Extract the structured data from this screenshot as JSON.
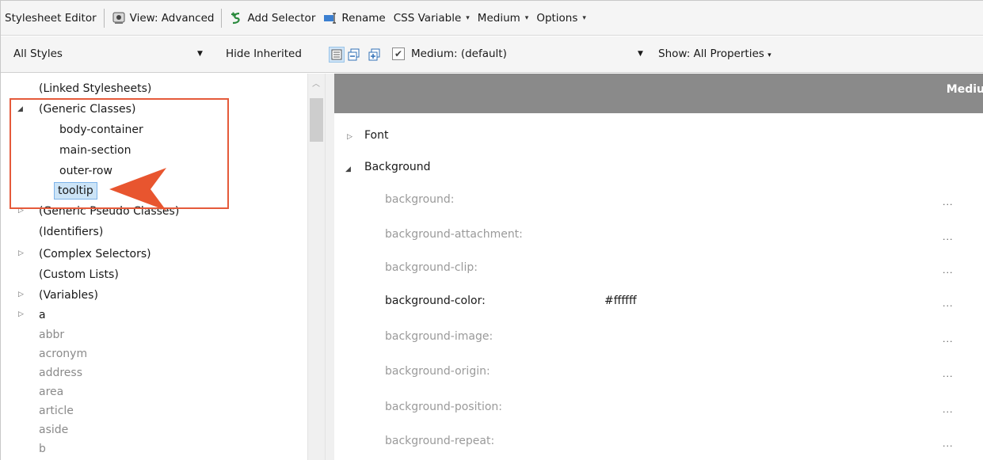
{
  "toolbar1": {
    "title": "Stylesheet Editor",
    "view": "View: Advanced",
    "add_selector": "Add Selector",
    "rename": "Rename",
    "css_variable": "CSS Variable",
    "medium": "Medium",
    "options": "Options"
  },
  "toolbar2": {
    "filter": "All Styles",
    "hide_inherited": "Hide Inherited",
    "medium_select": "Medium: (default)",
    "show": "Show: All Properties"
  },
  "tree": {
    "linked": "(Linked Stylesheets)",
    "generic_classes": "(Generic Classes)",
    "classes": [
      "body-container",
      "main-section",
      "outer-row",
      "tooltip"
    ],
    "generic_pseudo": "(Generic Pseudo Classes)",
    "identifiers": "(Identifiers)",
    "complex": "(Complex Selectors)",
    "custom_lists": "(Custom Lists)",
    "variables": "(Variables)",
    "a": "a",
    "tags": [
      "abbr",
      "acronym",
      "address",
      "area",
      "article",
      "aside",
      "b"
    ]
  },
  "right": {
    "header": "Mediu",
    "sections": {
      "font": "Font",
      "background": "Background"
    },
    "props": [
      {
        "name": "background:",
        "value": ""
      },
      {
        "name": "background-attachment:",
        "value": ""
      },
      {
        "name": "background-clip:",
        "value": ""
      },
      {
        "name": "background-color:",
        "value": "#ffffff"
      },
      {
        "name": "background-image:",
        "value": ""
      },
      {
        "name": "background-origin:",
        "value": ""
      },
      {
        "name": "background-position:",
        "value": ""
      },
      {
        "name": "background-repeat:",
        "value": ""
      }
    ],
    "ellipsis": "..."
  },
  "colors": {
    "highlight": "#e55a3a",
    "header_band": "#8a8a8a",
    "selection": "#cce4f7"
  }
}
